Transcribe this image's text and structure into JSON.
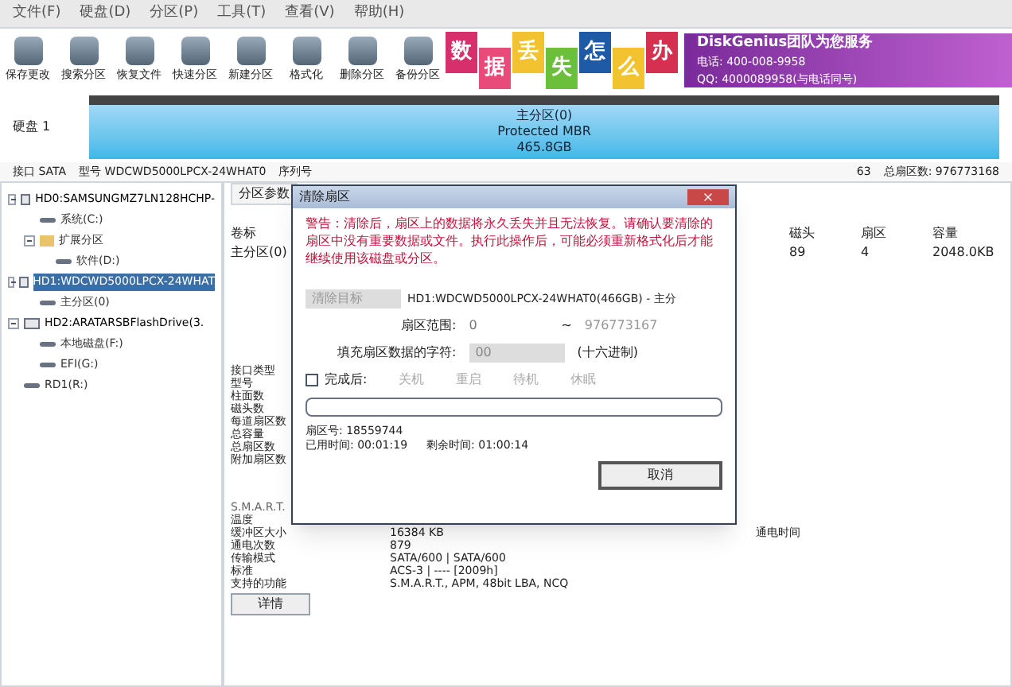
{
  "menu": [
    "文件(F)",
    "硬盘(D)",
    "分区(P)",
    "工具(T)",
    "查看(V)",
    "帮助(H)"
  ],
  "toolbar": [
    "保存更改",
    "搜索分区",
    "恢复文件",
    "快速分区",
    "新建分区",
    "格式化",
    "删除分区",
    "备份分区"
  ],
  "banner": {
    "chars": [
      "数",
      "据",
      "丢",
      "失",
      "怎",
      "么",
      "办"
    ],
    "slogan": "DiskGenius团队为您服务",
    "phone": "电话: 400-008-9958",
    "qq": "QQ: 4000089958(与电话同号)"
  },
  "disk_map": {
    "label": "硬盘 1",
    "name": "主分区(0)",
    "type": "Protected MBR",
    "size": "465.8GB"
  },
  "info_bar": {
    "interface": "接口 SATA",
    "model": "型号 WDCWD5000LPCX-24WHAT0",
    "serial": "序列号",
    "sectors_per_track": "63",
    "total_sectors": "总扇区数: 976773168"
  },
  "tree": [
    {
      "label": "HD0:SAMSUNGMZ7LN128HCHP-",
      "kind": "disk",
      "expanded": true,
      "selected": false,
      "children": [
        {
          "label": "系统(C:)",
          "kind": "part",
          "selected": false
        },
        {
          "label": "扩展分区",
          "kind": "ext",
          "expanded": true,
          "selected": false,
          "children": [
            {
              "label": "软件(D:)",
              "kind": "part",
              "selected": false
            }
          ]
        }
      ]
    },
    {
      "label": "HD1:WDCWD5000LPCX-24WHAT",
      "kind": "disk",
      "expanded": true,
      "selected": true,
      "children": [
        {
          "label": "主分区(0)",
          "kind": "part",
          "selected": false
        }
      ]
    },
    {
      "label": "HD2:ARATARSBFlashDrive(3.",
      "kind": "disk",
      "expanded": true,
      "selected": false,
      "children": [
        {
          "label": "本地磁盘(F:)",
          "kind": "part",
          "selected": false
        },
        {
          "label": "EFI(G:)",
          "kind": "part",
          "selected": false
        }
      ]
    },
    {
      "label": "RD1(R:)",
      "kind": "part",
      "selected": false
    }
  ],
  "partition_panel": {
    "tab": "分区参数",
    "columns": [
      "卷标",
      "磁头",
      "扇区",
      "容量"
    ],
    "row": [
      "主分区(0)",
      "89",
      "4",
      "2048.0KB"
    ]
  },
  "disk_details": [
    {
      "label": "接口类型"
    },
    {
      "label": "型号"
    },
    {
      "label": "柱面数"
    },
    {
      "label": "磁头数"
    },
    {
      "label": "每道扇区数"
    },
    {
      "label": "总容量"
    },
    {
      "label": "总扇区数"
    },
    {
      "label": "附加扇区数"
    }
  ],
  "smart": {
    "title": "S.M.A.R.T.",
    "rows": [
      {
        "label": "温度"
      },
      {
        "label": "缓冲区大小",
        "value": "16384 KB"
      },
      {
        "label": "通电次数",
        "value": "879"
      },
      {
        "label": "传输模式",
        "value": "SATA/600 | SATA/600"
      },
      {
        "label": "标准",
        "value": "ACS-3 | ---- [2009h]"
      },
      {
        "label": "支持的功能",
        "value": "S.M.A.R.T., APM, 48bit LBA, NCQ"
      }
    ],
    "power_on_label": "通电时间",
    "button": "详情"
  },
  "dialog": {
    "title": "清除扇区",
    "warning": "警告：清除后，扇区上的数据将永久丢失并且无法恢复。请确认要清除的扇区中没有重要数据或文件。执行此操作后，可能必须重新格式化后才能继续使用该磁盘或分区。",
    "target_label": "清除目标",
    "target": "HD1:WDCWD5000LPCX-24WHAT0(466GB) - 主分",
    "range_label": "扇区范围:",
    "range_from": "0",
    "range_sep": "~",
    "range_to": "976773167",
    "fill_label": "填充扇区数据的字符:",
    "fill_value": "00",
    "fill_unit": "(十六进制)",
    "after_label": "完成后:",
    "after_checked": false,
    "after_options": [
      "关机",
      "重启",
      "待机",
      "休眠"
    ],
    "progress": {
      "level": 0
    },
    "sector": "扇区号: 18559744",
    "elapsed": "已用时间: 00:01:19",
    "remaining": "剩余时间: 01:00:14",
    "cancel": "取消"
  }
}
